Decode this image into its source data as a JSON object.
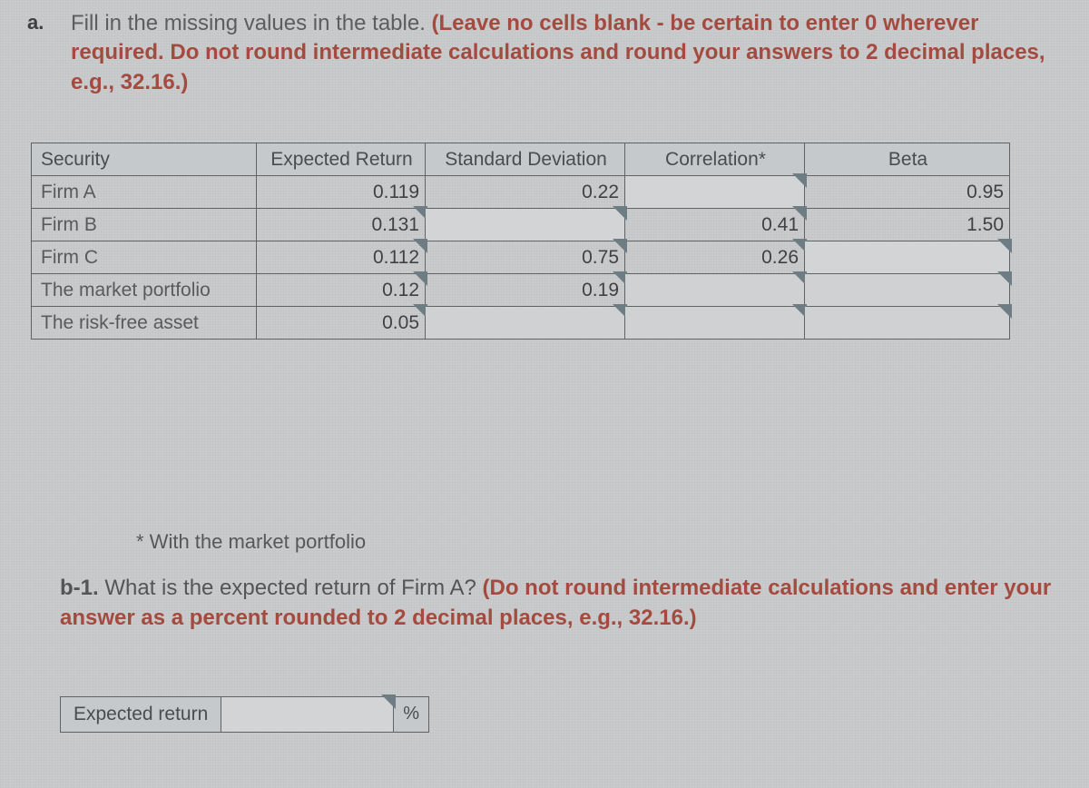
{
  "partA": {
    "label": "a.",
    "prompt_lead": "Fill in the missing values in the table.",
    "prompt_red": " (Leave no cells blank - be certain to enter 0 wherever required. Do not round intermediate calculations and round your answers to 2 decimal places, e.g., 32.16.)"
  },
  "table": {
    "headers": {
      "security": "Security",
      "expected_return": "Expected Return",
      "std_dev": "Standard Deviation",
      "correlation": "Correlation*",
      "beta": "Beta"
    },
    "rows": [
      {
        "name": "Firm A",
        "exp": "0.119",
        "sd": "0.22",
        "cor": "",
        "beta": "0.95",
        "sd_input": false,
        "cor_input": true,
        "beta_input": false
      },
      {
        "name": "Firm B",
        "exp": "0.131",
        "sd": "",
        "cor": "0.41",
        "beta": "1.50",
        "sd_input": true,
        "cor_input": false,
        "beta_input": false
      },
      {
        "name": "Firm C",
        "exp": "0.112",
        "sd": "0.75",
        "cor": "0.26",
        "beta": "",
        "sd_input": false,
        "cor_input": false,
        "beta_input": true
      },
      {
        "name": "The market portfolio",
        "exp": "0.12",
        "sd": "0.19",
        "cor": "",
        "beta": "",
        "sd_input": false,
        "cor_input": true,
        "beta_input": true,
        "cor_disabled": true,
        "beta_disabled": true
      },
      {
        "name": "The risk-free asset",
        "exp": "0.05",
        "sd": "",
        "cor": "",
        "beta": "",
        "sd_input": true,
        "cor_input": true,
        "beta_input": true,
        "sd_disabled": true,
        "cor_disabled": true,
        "beta_disabled": true
      }
    ]
  },
  "footnote": "* With the market portfolio",
  "partB": {
    "label": "b-1.",
    "question": " What is the expected return of Firm A? ",
    "red": "(Do not round intermediate calculations and enter your answer as a percent rounded to 2 decimal places, e.g., 32.16.)"
  },
  "answer": {
    "label": "Expected return",
    "unit": "%"
  },
  "chart_data": {
    "type": "table",
    "columns": [
      "Security",
      "Expected Return",
      "Standard Deviation",
      "Correlation*",
      "Beta"
    ],
    "rows": [
      [
        "Firm A",
        0.119,
        0.22,
        null,
        0.95
      ],
      [
        "Firm B",
        0.131,
        null,
        0.41,
        1.5
      ],
      [
        "Firm C",
        0.112,
        0.75,
        0.26,
        null
      ],
      [
        "The market portfolio",
        0.12,
        0.19,
        null,
        null
      ],
      [
        "The risk-free asset",
        0.05,
        null,
        null,
        null
      ]
    ],
    "footnote": "* With the market portfolio"
  }
}
